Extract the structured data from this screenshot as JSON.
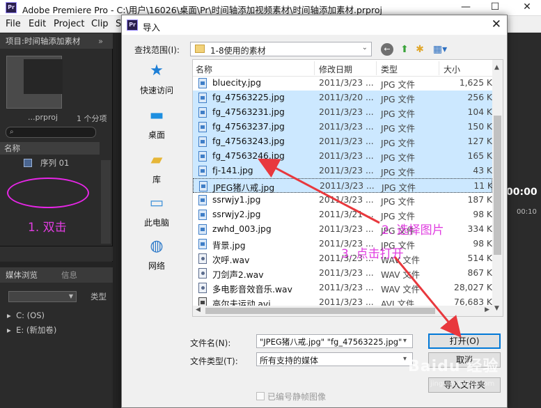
{
  "premiere": {
    "window_title": "Adobe Premiere Pro - C:\\用户\\16026\\桌面\\Pr\\时间轴添加视频素材\\时间轴添加素材.prproj",
    "logo_text": "Pr",
    "menu": [
      "File",
      "Edit",
      "Project",
      "Clip",
      "S"
    ],
    "project_panel": {
      "tab_label": "项目:时间轴添加素材",
      "project_file": "...prproj",
      "item_count": "1 个分项",
      "name_column": "名称",
      "sequence_name": "序列 01"
    },
    "media_panel": {
      "tab_label": "媒体浏览",
      "info_tab": "信息",
      "type_label": "类型",
      "drives": [
        "C: (OS)",
        "E: (新加卷)"
      ]
    },
    "timecode": "00:00",
    "ruler_time": "00:10"
  },
  "annotations": {
    "step1": "1. 双击",
    "step2": "2. 选择图片",
    "step3": "3. 点击打开",
    "color": "#e03de0"
  },
  "dialog": {
    "title": "导入",
    "logo_text": "Pr",
    "look_in_label": "查找范围(I):",
    "look_in_value": "1-8使用的素材",
    "places": [
      "快速访问",
      "桌面",
      "库",
      "此电脑",
      "网络"
    ],
    "columns": [
      "名称",
      "修改日期",
      "类型",
      "大小"
    ],
    "files": [
      {
        "name": "bluecity.jpg",
        "date": "2011/3/23 ...",
        "type": "JPG 文件",
        "size": "1,625 K",
        "icon": "image",
        "state": "normal"
      },
      {
        "name": "fg_47563225.jpg",
        "date": "2011/3/20 ...",
        "type": "JPG 文件",
        "size": "256 K",
        "icon": "image",
        "state": "selected"
      },
      {
        "name": "fg_47563231.jpg",
        "date": "2011/3/23 ...",
        "type": "JPG 文件",
        "size": "104 K",
        "icon": "image",
        "state": "selected"
      },
      {
        "name": "fg_47563237.jpg",
        "date": "2011/3/23 ...",
        "type": "JPG 文件",
        "size": "150 K",
        "icon": "image",
        "state": "selected"
      },
      {
        "name": "fg_47563243.jpg",
        "date": "2011/3/23 ...",
        "type": "JPG 文件",
        "size": "127 K",
        "icon": "image",
        "state": "selected"
      },
      {
        "name": "fg_47563246.jpg",
        "date": "2011/3/23 ...",
        "type": "JPG 文件",
        "size": "165 K",
        "icon": "image",
        "state": "selected"
      },
      {
        "name": "fj-141.jpg",
        "date": "2011/3/23 ...",
        "type": "JPG 文件",
        "size": "43 K",
        "icon": "image",
        "state": "selected"
      },
      {
        "name": "JPEG猪八戒.jpg",
        "date": "2011/3/23 ...",
        "type": "JPG 文件",
        "size": "11 K",
        "icon": "image",
        "state": "focused"
      },
      {
        "name": "ssrwjy1.jpg",
        "date": "2011/3/23 ...",
        "type": "JPG 文件",
        "size": "187 K",
        "icon": "image",
        "state": "normal"
      },
      {
        "name": "ssrwjy2.jpg",
        "date": "2011/3/21 ...",
        "type": "JPG 文件",
        "size": "98 K",
        "icon": "image",
        "state": "normal"
      },
      {
        "name": "zwhd_003.jpg",
        "date": "2011/3/23 ...",
        "type": "JPG 文件",
        "size": "334 K",
        "icon": "image",
        "state": "normal"
      },
      {
        "name": "背景.jpg",
        "date": "2011/3/23 ...",
        "type": "JPG 文件",
        "size": "98 K",
        "icon": "image",
        "state": "normal"
      },
      {
        "name": "次呼.wav",
        "date": "2011/3/23 ...",
        "type": "WAV 文件",
        "size": "514 K",
        "icon": "audio",
        "state": "normal"
      },
      {
        "name": "刀剑声2.wav",
        "date": "2011/3/23 ...",
        "type": "WAV 文件",
        "size": "867 K",
        "icon": "audio",
        "state": "normal"
      },
      {
        "name": "多电影音效音乐.wav",
        "date": "2011/3/23 ...",
        "type": "WAV 文件",
        "size": "28,027 K",
        "icon": "audio",
        "state": "normal"
      },
      {
        "name": "高尔夫运动.avi",
        "date": "2011/3/23 ...",
        "type": "AVI 文件",
        "size": "76,683 K",
        "icon": "video",
        "state": "normal"
      }
    ],
    "filename_label": "文件名(N):",
    "filename_value": "\"JPEG猪八戒.jpg\" \"fg_47563225.jpg\"",
    "filetype_label": "文件类型(T):",
    "filetype_value": "所有支持的媒体",
    "open_button": "打开(O)",
    "cancel_button": "取消",
    "import_folder_button": "导入文件夹",
    "image_sequence_label": "已编号静帧图像"
  },
  "watermark": {
    "text": "Baidu 经验",
    "url": "jingyan.baidu.com"
  }
}
